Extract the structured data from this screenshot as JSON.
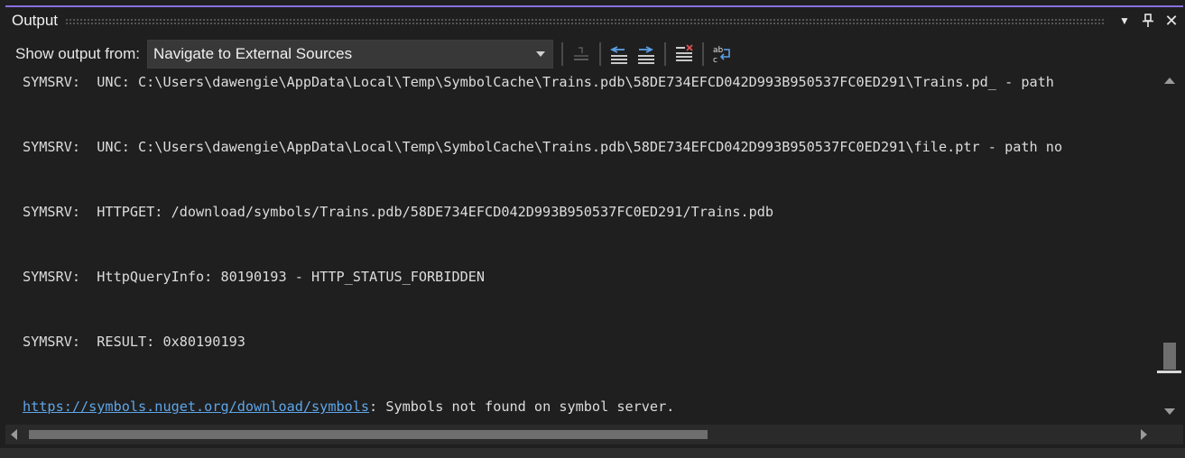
{
  "window": {
    "title": "Output",
    "accent_color": "#8a6fe0"
  },
  "title_buttons": {
    "dropdown_glyph": "▼",
    "pin_glyph": "⊥",
    "close_glyph": "✕"
  },
  "toolbar": {
    "show_output_label": "Show output from:",
    "selected_source": "Navigate to External Sources",
    "icons": [
      "find-message-icon",
      "previous-message-icon",
      "next-message-icon",
      "clear-all-icon",
      "toggle-word-wrap-icon"
    ]
  },
  "output": {
    "lines": [
      "SYMSRV:  UNC: C:\\Users\\dawengie\\AppData\\Local\\Temp\\SymbolCache\\Trains.pdb\\58DE734EFCD042D993B950537FC0ED291\\Trains.pd_ - path",
      "SYMSRV:  UNC: C:\\Users\\dawengie\\AppData\\Local\\Temp\\SymbolCache\\Trains.pdb\\58DE734EFCD042D993B950537FC0ED291\\file.ptr - path no",
      "SYMSRV:  HTTPGET: /download/symbols/Trains.pdb/58DE734EFCD042D993B950537FC0ED291/Trains.pdb",
      "SYMSRV:  HttpQueryInfo: 80190193 - HTTP_STATUS_FORBIDDEN",
      "SYMSRV:  RESULT: 0x80190193"
    ],
    "last_line_link": "https://symbols.nuget.org/download/symbols",
    "last_line_text": ": Symbols not found on symbol server."
  }
}
